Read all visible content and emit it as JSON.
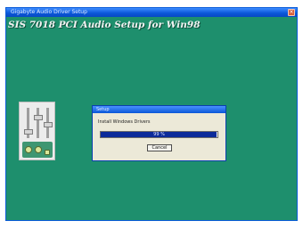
{
  "window": {
    "title": "Gigabyte Audio Driver Setup",
    "close_glyph": "×",
    "background_color": "#1e8f6d",
    "titlebar_color": "#0a56d8"
  },
  "heading": "SIS 7018 PCI Audio Setup for Win98",
  "mixer_icon": {
    "icon": "audio-mixer-icon"
  },
  "dialog": {
    "title": "Setup",
    "message": "Install Windows Drivers",
    "progress_text": "99 %",
    "progress_fraction": 0.99,
    "cancel_label": "Cancel"
  }
}
